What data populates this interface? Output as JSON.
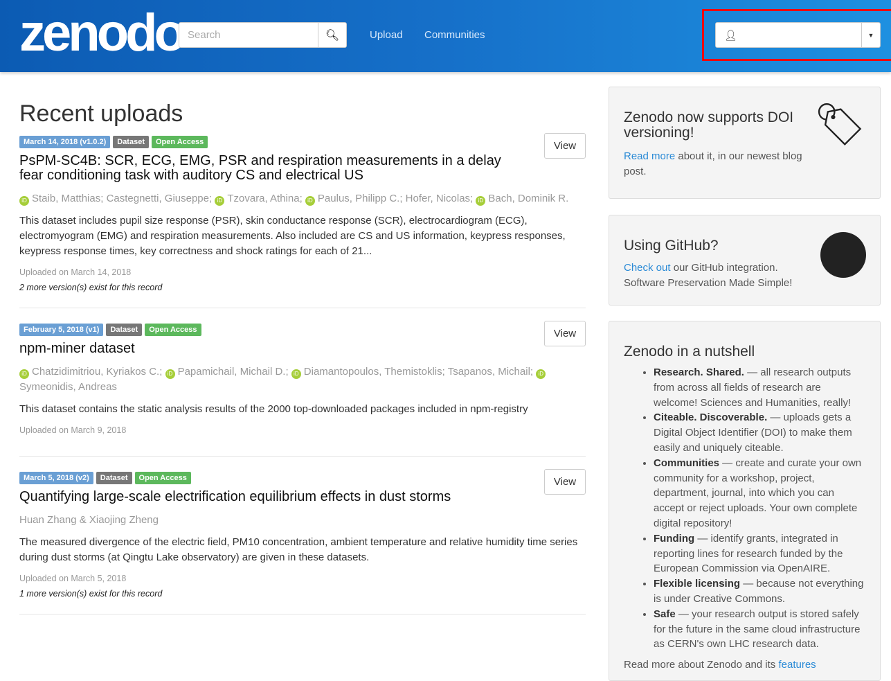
{
  "header": {
    "logo": "zenodo",
    "search_placeholder": "Search",
    "nav": [
      "Upload",
      "Communities"
    ]
  },
  "main": {
    "heading": "Recent uploads",
    "view_label": "View",
    "records": [
      {
        "date": "March 14, 2018 (v1.0.2)",
        "type": "Dataset",
        "access": "Open Access",
        "title": "PsPM-SC4B: SCR, ECG, EMG, PSR and respiration measurements in a delay fear conditioning task with auditory CS and electrical US",
        "authors": [
          {
            "name": "Staib, Matthias",
            "orcid": true
          },
          {
            "name": "Castegnetti, Giuseppe",
            "orcid": false
          },
          {
            "name": "Tzovara, Athina",
            "orcid": true
          },
          {
            "name": "Paulus, Philipp C.",
            "orcid": true
          },
          {
            "name": "Hofer, Nicolas",
            "orcid": false
          },
          {
            "name": "Bach, Dominik R.",
            "orcid": true
          }
        ],
        "description": "This dataset includes pupil size response (PSR), skin conductance response (SCR), electrocardiogram (ECG), electromyogram (EMG) and respiration measurements. Also included are CS and US information, keypress responses, keypress response times, key correctness and shock ratings for each of 21...",
        "uploaded": "Uploaded on March 14, 2018",
        "versions": "2 more version(s) exist for this record"
      },
      {
        "date": "February 5, 2018 (v1)",
        "type": "Dataset",
        "access": "Open Access",
        "title": "npm-miner dataset",
        "authors": [
          {
            "name": "Chatzidimitriou, Kyriakos C.",
            "orcid": true
          },
          {
            "name": "Papamichail, Michail D.",
            "orcid": true
          },
          {
            "name": "Diamantopoulos, Themistoklis",
            "orcid": true
          },
          {
            "name": "Tsapanos, Michail",
            "orcid": false
          },
          {
            "name": "Symeonidis, Andreas",
            "orcid": true
          }
        ],
        "description": "This dataset contains the static analysis results of the 2000 top-downloaded packages included in npm-registry",
        "uploaded": "Uploaded on March 9, 2018",
        "versions": ""
      },
      {
        "date": "March 5, 2018 (v2)",
        "type": "Dataset",
        "access": "Open Access",
        "title": "Quantifying large-scale electrification equilibrium effects in dust storms",
        "authors_text": "Huan Zhang & Xiaojing Zheng",
        "description": "The measured divergence of the electric field, PM10 concentration, ambient temperature and relative humidity time series during dust storms (at Qingtu Lake observatory) are given in these datasets.",
        "uploaded": "Uploaded on March 5, 2018",
        "versions": "1 more version(s) exist for this record"
      }
    ]
  },
  "sidebar": {
    "doi": {
      "title": "Zenodo now supports DOI versioning!",
      "link": "Read more",
      "text": " about it, in our newest blog post."
    },
    "github": {
      "title": "Using GitHub?",
      "link": "Check out",
      "text": " our GitHub integration. Software Preservation Made Simple!"
    },
    "nutshell": {
      "title": "Zenodo in a nutshell",
      "items": [
        {
          "bold": "Research. Shared.",
          "text": " — all research outputs from across all fields of research are welcome! Sciences and Humanities, really!"
        },
        {
          "bold": "Citeable. Discoverable.",
          "text": " — uploads gets a Digital Object Identifier (DOI) to make them easily and uniquely citeable."
        },
        {
          "bold": "Communities",
          "text": " — create and curate your own community for a workshop, project, department, journal, into which you can accept or reject uploads. Your own complete digital repository!"
        },
        {
          "bold": "Funding",
          "text": " — identify grants, integrated in reporting lines for research funded by the European Commission via OpenAIRE."
        },
        {
          "bold": "Flexible licensing",
          "text": " — because not everything is under Creative Commons."
        },
        {
          "bold": "Safe",
          "text": " — your research output is stored safely for the future in the same cloud infrastructure as CERN's own LHC research data."
        }
      ],
      "footer": "Read more about Zenodo and its ",
      "footer_link": "features"
    }
  }
}
